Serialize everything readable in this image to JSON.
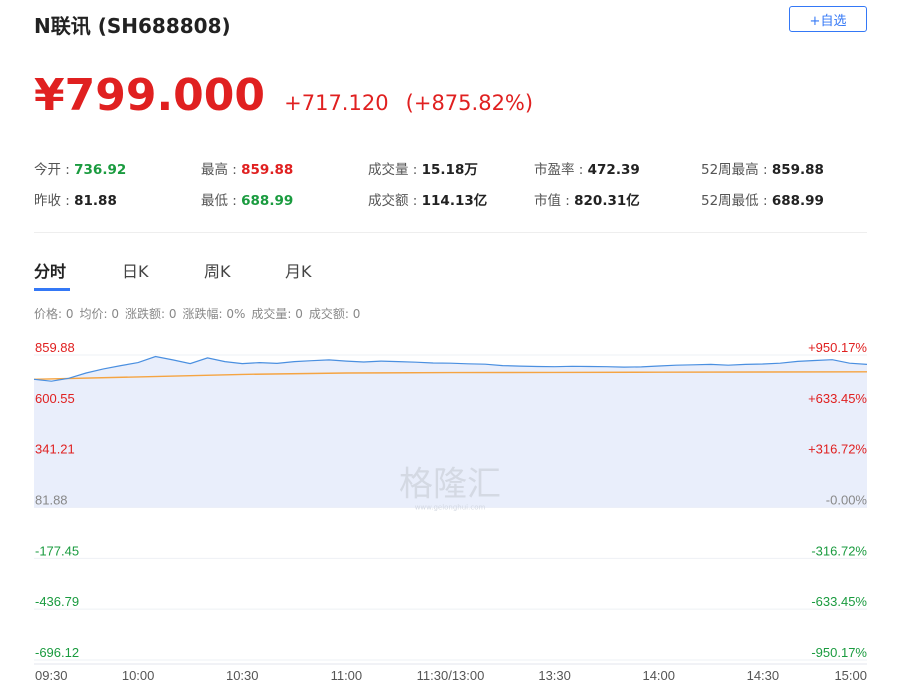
{
  "header": {
    "title": "N联讯 (SH688808)",
    "add_button": "+自选"
  },
  "quote": {
    "price": "¥799.000",
    "change": "+717.120",
    "change_pct": "(+875.82%)"
  },
  "stats": [
    {
      "label": "今开 : ",
      "value": "736.92",
      "tone": "green"
    },
    {
      "label": "最高 : ",
      "value": "859.88",
      "tone": "red"
    },
    {
      "label": "成交量 : ",
      "value": "15.18万",
      "tone": "dark"
    },
    {
      "label": "市盈率 : ",
      "value": "472.39",
      "tone": "dark"
    },
    {
      "label": "52周最高 : ",
      "value": "859.88",
      "tone": "dark"
    },
    {
      "label": "昨收 : ",
      "value": "81.88",
      "tone": "dark"
    },
    {
      "label": "最低 : ",
      "value": "688.99",
      "tone": "green"
    },
    {
      "label": "成交额 : ",
      "value": "114.13亿",
      "tone": "dark"
    },
    {
      "label": "市值 : ",
      "value": "820.31亿",
      "tone": "dark"
    },
    {
      "label": "52周最低 : ",
      "value": "688.99",
      "tone": "dark"
    }
  ],
  "tabs": [
    "分时",
    "日K",
    "周K",
    "月K"
  ],
  "active_tab": "分时",
  "info_bar": [
    "价格: 0",
    "均价: 0",
    "涨跌额: 0",
    "涨跌幅: 0%",
    "成交量: 0",
    "成交额: 0"
  ],
  "watermark": {
    "text": "格隆汇",
    "url": "www.gelonghui.com"
  },
  "colors": {
    "up": "#e02020",
    "down": "#1a9b3f",
    "accent": "#3478f6",
    "price_line": "#4a8fe0",
    "avg_line": "#f5a442",
    "area_fill": "#e9eefb"
  },
  "chart_data": {
    "type": "line",
    "y_left_ticks": [
      "859.88",
      "600.55",
      "341.21",
      "81.88",
      "-177.45",
      "-436.79",
      "-696.12"
    ],
    "y_left_values": [
      859.88,
      600.55,
      341.21,
      81.88,
      -177.45,
      -436.79,
      -696.12
    ],
    "y_right_ticks": [
      "+950.17%",
      "+633.45%",
      "+316.72%",
      "-0.00%",
      "-316.72%",
      "-633.45%",
      "-950.17%"
    ],
    "x_ticks": [
      "09:30",
      "10:00",
      "10:30",
      "11:00",
      "11:30/13:00",
      "13:30",
      "14:00",
      "14:30",
      "15:00"
    ],
    "ylim": [
      -696.12,
      859.88
    ],
    "base_value": 81.88,
    "series": [
      {
        "role": "price",
        "x": [
          "09:30",
          "09:35",
          "09:40",
          "09:45",
          "09:50",
          "09:55",
          "10:00",
          "10:05",
          "10:10",
          "10:15",
          "10:20",
          "10:25",
          "10:30",
          "10:35",
          "10:40",
          "10:45",
          "10:50",
          "10:55",
          "11:00",
          "11:05",
          "11:10",
          "11:15",
          "11:20",
          "11:25",
          "11:30",
          "13:05",
          "13:10",
          "13:15",
          "13:20",
          "13:25",
          "13:30",
          "13:35",
          "13:40",
          "13:45",
          "13:50",
          "13:55",
          "14:00",
          "14:05",
          "14:10",
          "14:15",
          "14:20",
          "14:25",
          "14:30",
          "14:35",
          "14:40",
          "14:45",
          "14:50",
          "14:55",
          "15:00"
        ],
        "values": [
          736,
          726,
          741,
          768,
          789,
          806,
          821,
          852,
          835,
          816,
          845,
          826,
          816,
          821,
          817,
          826,
          831,
          835,
          829,
          824,
          829,
          826,
          823,
          819,
          818,
          815,
          813,
          806,
          803,
          801,
          800,
          802,
          801,
          800,
          798,
          799,
          804,
          808,
          810,
          812,
          808,
          812,
          814,
          818,
          827,
          832,
          836,
          818,
          812
        ]
      },
      {
        "role": "average",
        "x": [
          "09:30",
          "10:00",
          "10:30",
          "11:00",
          "11:30",
          "13:30",
          "14:00",
          "14:30",
          "15:00"
        ],
        "values": [
          736,
          748,
          761,
          768,
          770,
          771,
          772,
          773,
          774
        ]
      }
    ]
  }
}
